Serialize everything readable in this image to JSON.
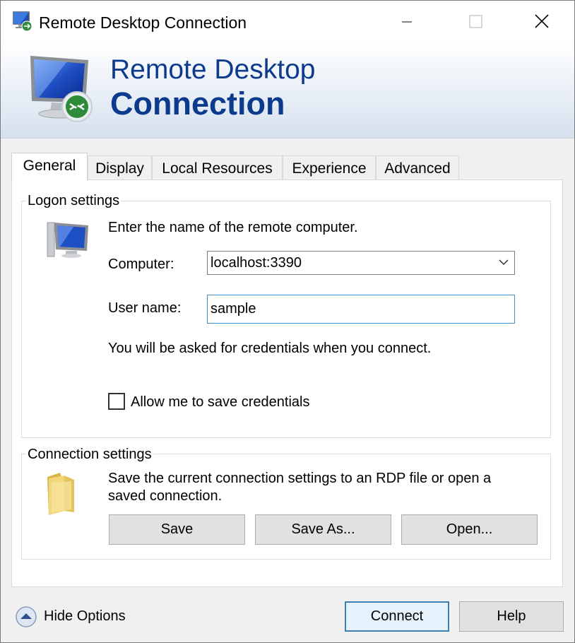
{
  "window": {
    "title": "Remote Desktop Connection",
    "controls": {
      "minimize": "minimize",
      "maximize": "maximize",
      "close": "close"
    }
  },
  "banner": {
    "line1": "Remote Desktop",
    "line2": "Connection",
    "icon": "remote-desktop-monitor-icon"
  },
  "tabs": [
    {
      "label": "General",
      "active": true
    },
    {
      "label": "Display",
      "active": false
    },
    {
      "label": "Local Resources",
      "active": false
    },
    {
      "label": "Experience",
      "active": false
    },
    {
      "label": "Advanced",
      "active": false
    }
  ],
  "logon": {
    "group_label": "Logon settings",
    "instruction": "Enter the name of the remote computer.",
    "computer_label": "Computer:",
    "computer_value": "localhost:3390",
    "username_label": "User name:",
    "username_value": "sample",
    "credentials_note": "You will be asked for credentials when you connect.",
    "save_credentials_label": "Allow me to save credentials",
    "save_credentials_checked": false
  },
  "connection": {
    "group_label": "Connection settings",
    "description_line1": "Save the current connection settings to an RDP file or open a",
    "description_line2": "saved connection.",
    "save_label": "Save",
    "save_as_label": "Save As...",
    "open_label": "Open..."
  },
  "footer": {
    "hide_options_label": "Hide Options",
    "connect_label": "Connect",
    "help_label": "Help"
  },
  "colors": {
    "banner_text": "#0c3a8d",
    "default_button_border": "#3c7fb1",
    "input_focus_border": "#3f8dd1"
  }
}
